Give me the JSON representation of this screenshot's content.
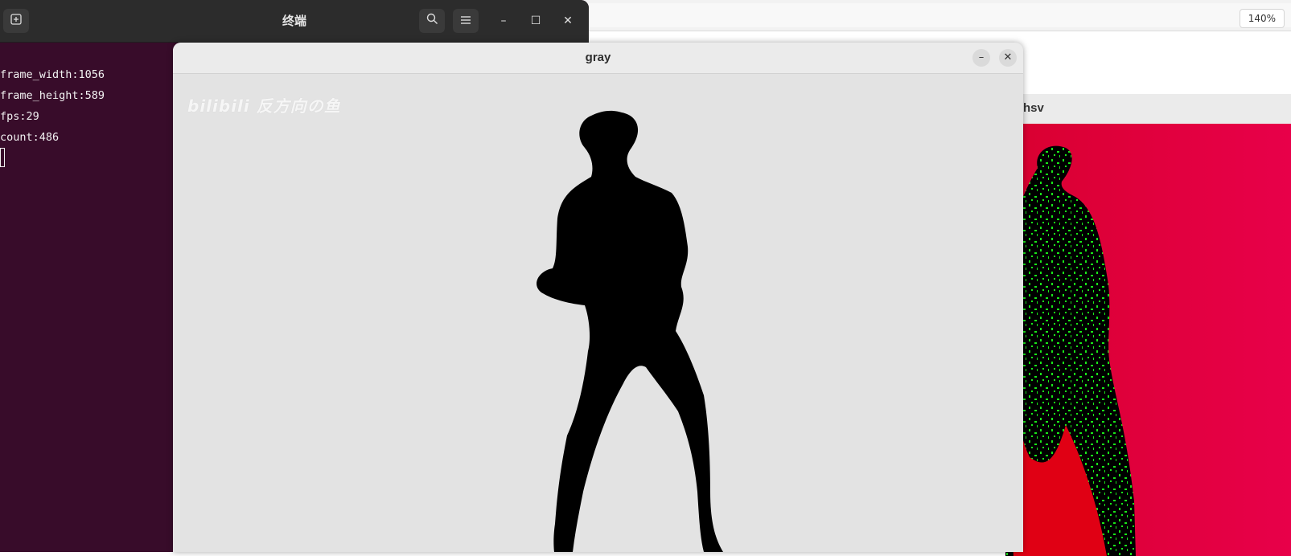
{
  "browser": {
    "zoom": "140%"
  },
  "terminal": {
    "title": "终端",
    "new_tab_icon": "new-tab-icon",
    "search_icon": "search-icon",
    "menu_icon": "hamburger-menu-icon",
    "minimize_glyph": "–",
    "maximize_glyph": "☐",
    "close_glyph": "✕",
    "lines": [
      "frame_width:1056",
      "frame_height:589",
      "fps:29",
      "count:486"
    ]
  },
  "gray_window": {
    "title": "gray",
    "minimize_glyph": "–",
    "close_glyph": "✕",
    "watermark": "bilibili 反方向の鱼"
  },
  "hsv_window": {
    "title": "hsv"
  },
  "colors": {
    "terminal_bg": "#380c2a",
    "hsv_background": "#e50040",
    "hsv_figure_highlight": "#19e619",
    "gray_background": "#e3e3e3",
    "silhouette": "#000000"
  }
}
